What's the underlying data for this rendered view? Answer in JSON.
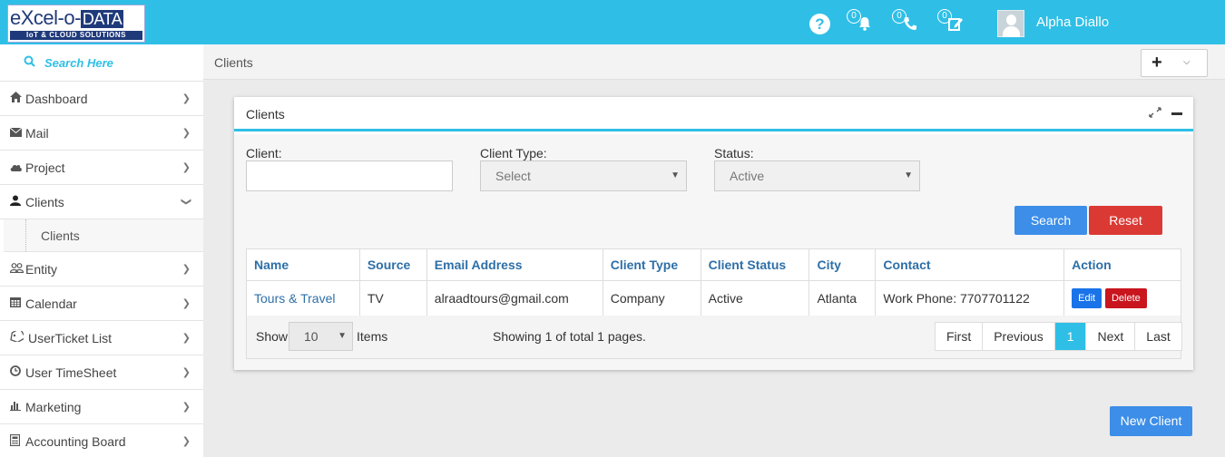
{
  "brand": {
    "logo_main_a": "eXcel-o-",
    "logo_main_b": "DATA",
    "logo_tag": "IoT & CLOUD SOLUTIONS"
  },
  "topbar": {
    "help_glyph": "?",
    "notifications_count": "0",
    "calls_count": "0",
    "tasks_count": "0",
    "user_name": "Alpha Diallo"
  },
  "sidebar": {
    "search_placeholder": "Search Here",
    "items": [
      {
        "label": "Dashboard",
        "icon": "home-icon"
      },
      {
        "label": "Mail",
        "icon": "envelope-icon"
      },
      {
        "label": "Project",
        "icon": "cloud-icon"
      },
      {
        "label": "Clients",
        "icon": "user-icon"
      },
      {
        "label": "Entity",
        "icon": "users-icon"
      },
      {
        "label": "Calendar",
        "icon": "calendar-icon"
      },
      {
        "label": "UserTicket List",
        "icon": "ticket-icon"
      },
      {
        "label": "User TimeSheet",
        "icon": "clock-icon"
      },
      {
        "label": "Marketing",
        "icon": "bar-chart-icon"
      },
      {
        "label": "Accounting Board",
        "icon": "calculator-icon"
      }
    ],
    "sub_items": [
      {
        "label": "Clients"
      }
    ]
  },
  "breadcrumb": {
    "current": "Clients"
  },
  "header_action": {
    "plus_glyph": "+",
    "caret_glyph": "⌵"
  },
  "panel": {
    "title": "Clients",
    "filters": {
      "client_label": "Client:",
      "client_value": "",
      "client_type_label": "Client Type:",
      "client_type_value": "Select",
      "status_label": "Status:",
      "status_value": "Active"
    },
    "search_label": "Search",
    "reset_label": "Reset",
    "table": {
      "columns": [
        "Name",
        "Source",
        "Email Address",
        "Client Type",
        "Client Status",
        "City",
        "Contact",
        "Action"
      ],
      "rows": [
        {
          "name": "Tours & Travel",
          "source": "TV",
          "email": "alraadtours@gmail.com",
          "client_type": "Company",
          "client_status": "Active",
          "city": "Atlanta",
          "contact": "Work Phone: 7707701122",
          "edit_label": "Edit",
          "delete_label": "Delete"
        }
      ]
    },
    "pager": {
      "show_label": "Show",
      "page_size": "10",
      "items_label": "Items",
      "info": "Showing 1 of total 1 pages.",
      "first": "First",
      "previous": "Previous",
      "current": "1",
      "next": "Next",
      "last": "Last"
    }
  },
  "new_client_label": "New Client",
  "colors": {
    "accent": "#2fbfe6",
    "primary": "#3c8ee8",
    "danger": "#db3a34",
    "link": "#2e6fa7"
  }
}
